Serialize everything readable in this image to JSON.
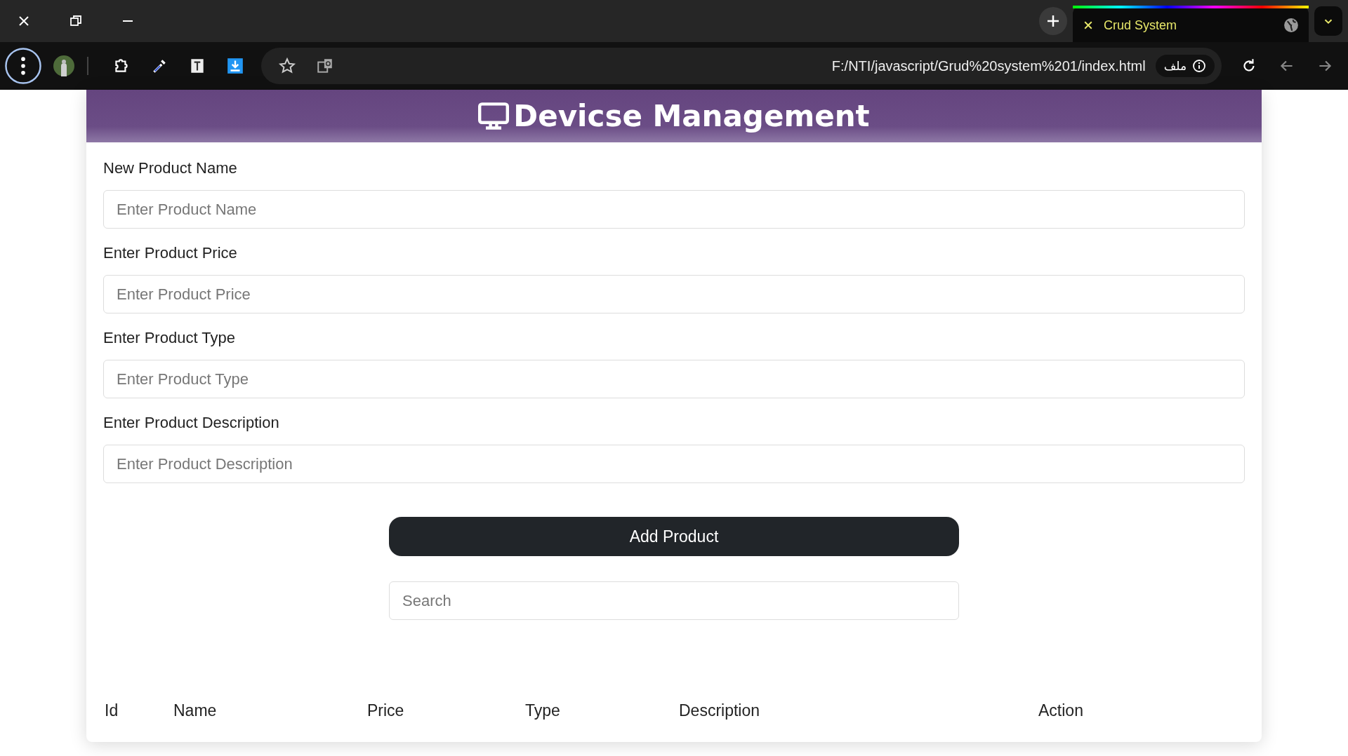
{
  "browser": {
    "tab": {
      "title": "Crud System",
      "selected": true
    },
    "address": "F:/NTI/javascript/Grud%20system%201/index.html",
    "site_info": "ملف"
  },
  "header": {
    "title": "Devicse Management"
  },
  "fields": [
    {
      "label": "New Product Name",
      "placeholder": "Enter Product Name"
    },
    {
      "label": "Enter Product Price",
      "placeholder": "Enter Product Price"
    },
    {
      "label": "Enter Product Type",
      "placeholder": "Enter Product Type"
    },
    {
      "label": "Enter Product Description",
      "placeholder": "Enter Product Description"
    }
  ],
  "add_button": "Add Product",
  "search": {
    "placeholder": "Search"
  },
  "table": {
    "columns": [
      "Id",
      "Name",
      "Price",
      "Type",
      "Description",
      "Action"
    ]
  }
}
